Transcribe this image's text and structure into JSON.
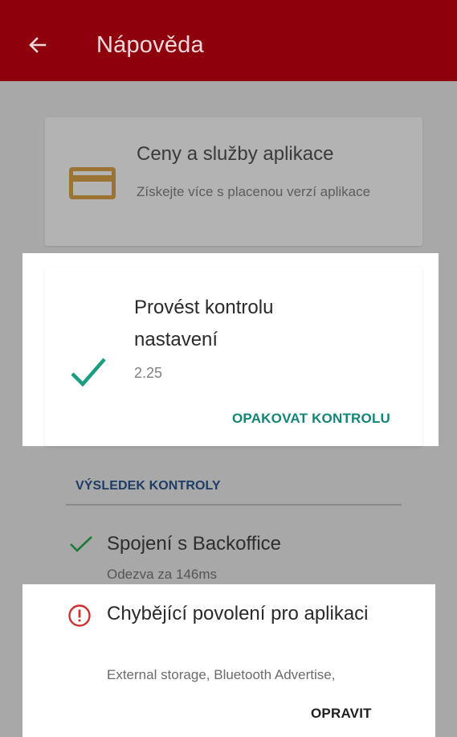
{
  "header": {
    "title": "Nápověda",
    "back_icon": "arrow-left-icon",
    "color": "#8e000b"
  },
  "pricing_card": {
    "title": "Ceny a služby aplikace",
    "subtitle": "Získejte více s placenou verzí aplikace",
    "icon": "credit-card-icon",
    "icon_color": "#9b7334"
  },
  "check_card": {
    "title": "Provést kontrolu nastavení",
    "version": "2.25",
    "action_label": "OPAKOVAT KONTROLU",
    "icon": "check-icon",
    "accent": "#1a9e82"
  },
  "results": {
    "heading": "VÝSLEDEK KONTROLY",
    "items": [
      {
        "status": "ok",
        "icon": "check-icon",
        "title": "Spojení s Backoffice",
        "detail": "Odezva za 146ms"
      },
      {
        "status": "error",
        "icon": "alert-circle-icon",
        "title": "Chybějící povolení pro aplikaci",
        "detail": "External storage, Bluetooth Advertise,",
        "action_label": "OPRAVIT",
        "error_color": "#d32f2f"
      }
    ]
  }
}
